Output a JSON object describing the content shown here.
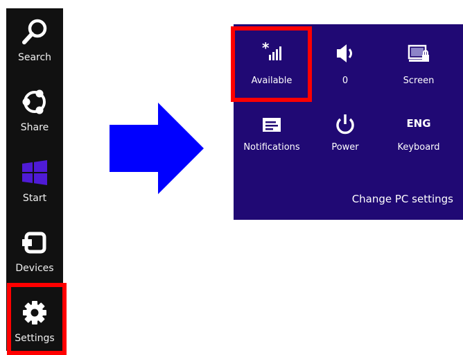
{
  "charms": {
    "items": [
      {
        "label": "Search",
        "icon": "search-icon"
      },
      {
        "label": "Share",
        "icon": "share-icon"
      },
      {
        "label": "Start",
        "icon": "windows-logo-icon"
      },
      {
        "label": "Devices",
        "icon": "devices-icon"
      },
      {
        "label": "Settings",
        "icon": "gear-icon"
      }
    ],
    "highlighted": "Settings"
  },
  "arrow": {
    "color": "#0000ff",
    "icon": "right-arrow-icon"
  },
  "settings_panel": {
    "background": "#200974",
    "tiles": [
      {
        "label": "Available",
        "icon": "network-signal-icon"
      },
      {
        "label": "0",
        "icon": "volume-icon"
      },
      {
        "label": "Screen",
        "icon": "screen-brightness-icon"
      },
      {
        "label": "Notifications",
        "icon": "notifications-icon"
      },
      {
        "label": "Power",
        "icon": "power-icon"
      },
      {
        "label": "Keyboard",
        "icon": "keyboard-icon",
        "icon_text": "ENG"
      }
    ],
    "change_pc_settings": "Change PC settings",
    "highlighted": "Available"
  },
  "colors": {
    "highlight": "#ff0000",
    "charms_bar": "#111111",
    "start_tile": "#4f1bd6"
  }
}
